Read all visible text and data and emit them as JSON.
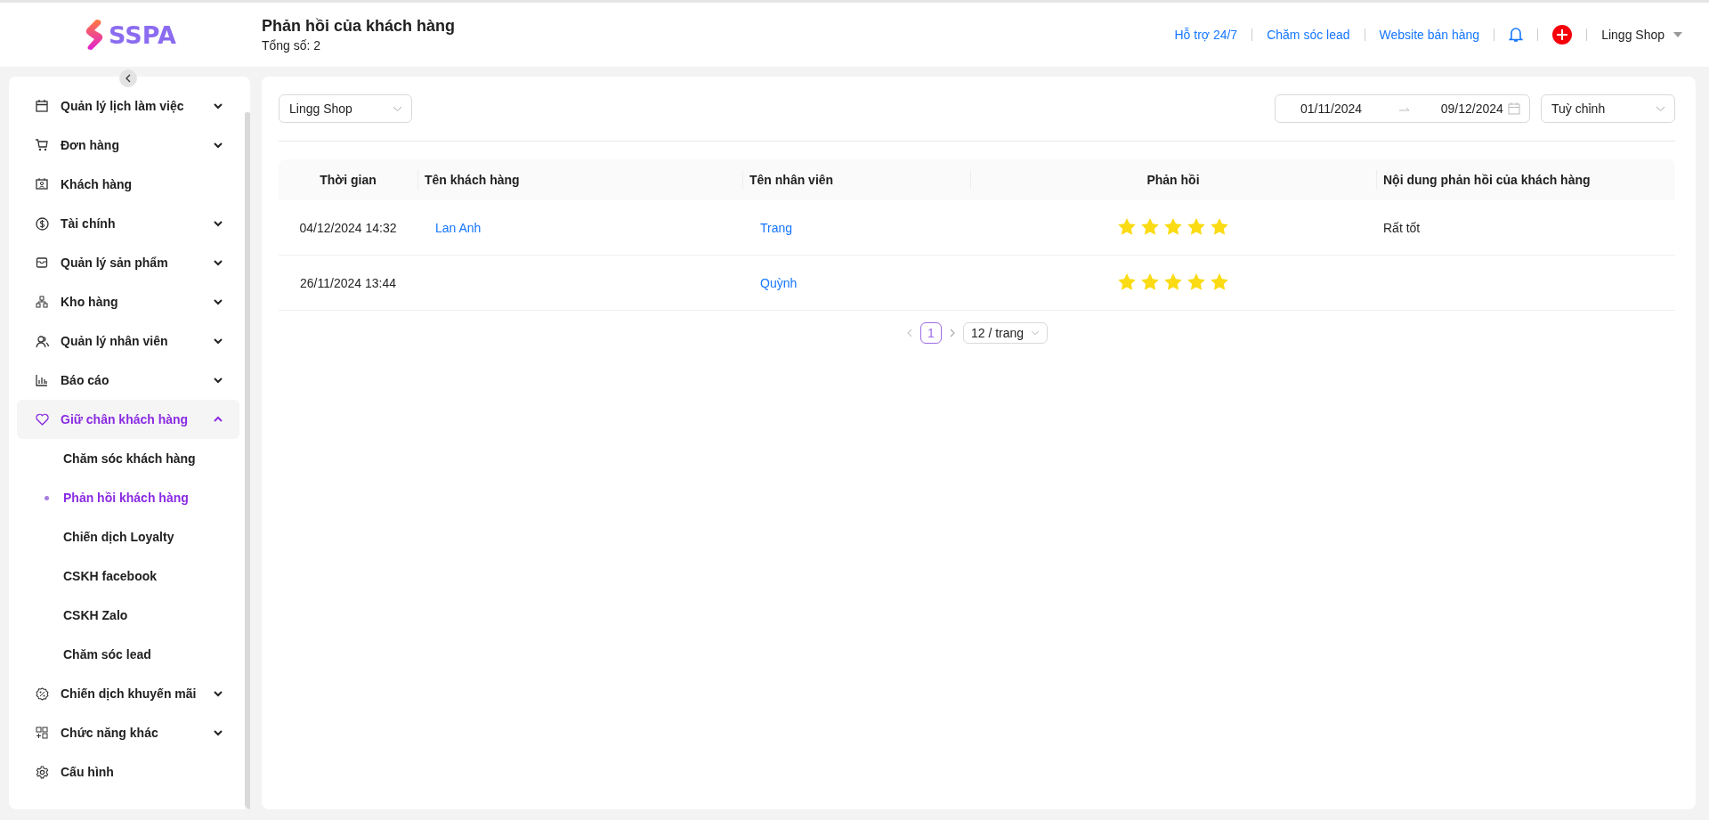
{
  "brand": {
    "logo_text": "SSPA"
  },
  "page": {
    "title": "Phản hồi của khách hàng",
    "total": "Tổng số: 2"
  },
  "top_links": [
    "Hỗ trợ 24/7",
    "Chăm sóc lead",
    "Website bán hàng"
  ],
  "account": {
    "name": "Lingg Shop"
  },
  "sidebar": {
    "items": [
      {
        "label": "Quản lý lịch làm việc",
        "kind": "group",
        "expanded": false,
        "selected": false
      },
      {
        "label": "Đơn hàng",
        "kind": "group",
        "expanded": false,
        "selected": false
      },
      {
        "label": "Khách hàng",
        "kind": "link",
        "selected": false
      },
      {
        "label": "Tài chính",
        "kind": "group",
        "expanded": false,
        "selected": false
      },
      {
        "label": "Quản lý sản phẩm",
        "kind": "group",
        "expanded": false,
        "selected": false
      },
      {
        "label": "Kho hàng",
        "kind": "group",
        "expanded": false,
        "selected": false
      },
      {
        "label": "Quản lý nhân viên",
        "kind": "group",
        "expanded": false,
        "selected": false
      },
      {
        "label": "Báo cáo",
        "kind": "group",
        "expanded": false,
        "selected": false
      },
      {
        "label": "Giữ chân khách hàng",
        "kind": "group",
        "expanded": true,
        "selected": true,
        "children": [
          {
            "label": "Chăm sóc khách hàng",
            "selected": false
          },
          {
            "label": "Phản hồi khách hàng",
            "selected": true
          },
          {
            "label": "Chiến dịch Loyalty",
            "selected": false
          },
          {
            "label": "CSKH facebook",
            "selected": false
          },
          {
            "label": "CSKH Zalo",
            "selected": false
          },
          {
            "label": "Chăm sóc lead",
            "selected": false
          }
        ]
      },
      {
        "label": "Chiến dịch khuyến mãi",
        "kind": "group",
        "expanded": false,
        "selected": false
      },
      {
        "label": "Chức năng khác",
        "kind": "group",
        "expanded": false,
        "selected": false
      },
      {
        "label": "Cấu hình",
        "kind": "link",
        "selected": false
      }
    ]
  },
  "filters": {
    "shop": {
      "value": "Lingg Shop"
    },
    "date_range": {
      "start": "01/11/2024",
      "end": "09/12/2024"
    },
    "period": {
      "value": "Tuỳ chỉnh"
    }
  },
  "table": {
    "columns": [
      "Thời gian",
      "Tên khách hàng",
      "Tên nhân viên",
      "Phản hồi",
      "Nội dung phản hồi của khách hàng"
    ],
    "rows": [
      {
        "time": "04/12/2024 14:32",
        "customer": "Lan Anh",
        "staff": "Trang",
        "stars": 5,
        "comment": "Rất tốt"
      },
      {
        "time": "26/11/2024 13:44",
        "staff": "Quỳnh",
        "stars": 5
      }
    ]
  },
  "pagination": {
    "pages": [
      {
        "label": "1",
        "selected": true
      }
    ],
    "page_size": "12 / trang"
  }
}
